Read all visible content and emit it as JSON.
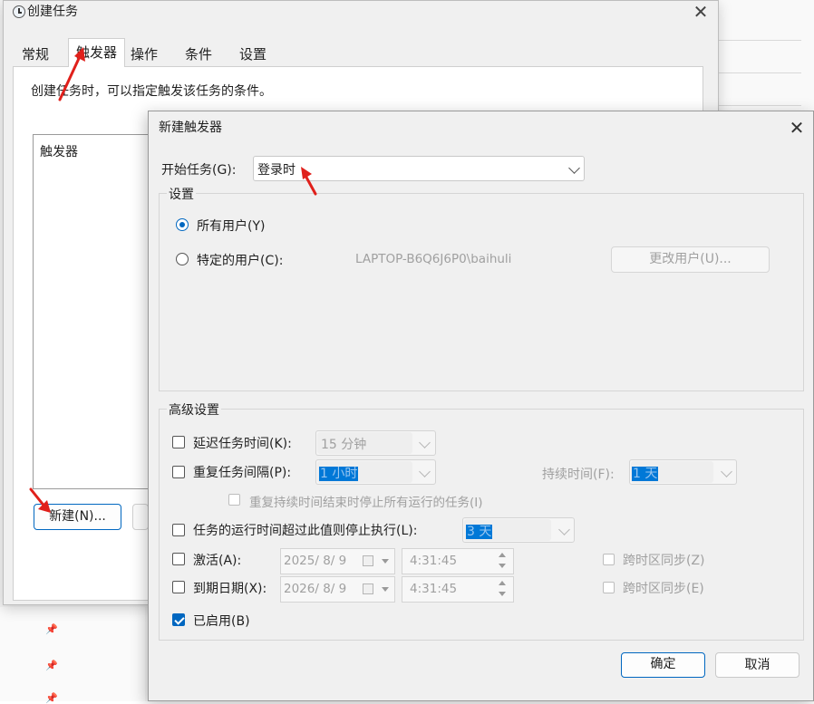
{
  "create_task": {
    "title": "创建任务",
    "tabs": [
      "常规",
      "触发器",
      "操作",
      "条件",
      "设置"
    ],
    "active_tab": "触发器",
    "description": "创建任务时，可以指定触发该任务的条件。",
    "trigger_list_header": "触发器",
    "new_button": "新建(N)..."
  },
  "new_trigger": {
    "title": "新建触发器",
    "begin_task_label": "开始任务(G):",
    "begin_task_value": "登录时",
    "settings_group": "设置",
    "radio_all_users": "所有用户(Y)",
    "radio_specific_user": "特定的用户(C):",
    "specific_user_value": "LAPTOP-B6Q6J6P0\\baihuli",
    "change_user_button": "更改用户(U)...",
    "advanced_group": "高级设置",
    "delay_label": "延迟任务时间(K):",
    "delay_value": "15 分钟",
    "repeat_label": "重复任务间隔(P):",
    "repeat_value": "1 小时",
    "duration_label": "持续时间(F):",
    "duration_value": "1 天",
    "stop_at_end_label": "重复持续时间结束时停止所有运行的任务(I)",
    "stop_if_runs_label": "任务的运行时间超过此值则停止执行(L):",
    "stop_if_runs_value": "3 天",
    "activate_label": "激活(A):",
    "activate_date": "2025/ 8/ 9",
    "activate_time": "4:31:45",
    "activate_sync": "跨时区同步(Z)",
    "expire_label": "到期日期(X):",
    "expire_date": "2026/ 8/ 9",
    "expire_time": "4:31:45",
    "expire_sync": "跨时区同步(E)",
    "enabled_label": "已启用(B)",
    "ok_button": "确定",
    "cancel_button": "取消"
  },
  "colors": {
    "accent": "#0067c0",
    "annotation_arrow": "#e0201b"
  }
}
